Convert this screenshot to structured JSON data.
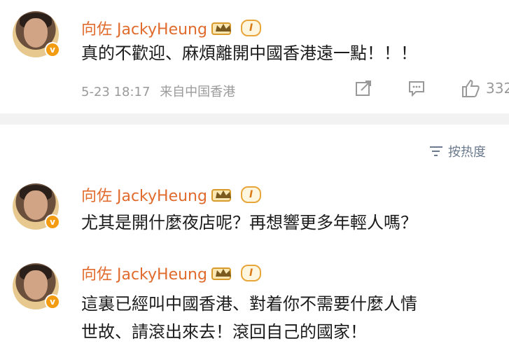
{
  "comments": [
    {
      "user_name": "向佐 JackyHeung",
      "level": "I",
      "text": "真的不歡迎、麻煩離開中國香港遠一點！！！",
      "time": "5-23 18:17",
      "source": "来自中国香港",
      "likes": "332"
    },
    {
      "user_name": "向佐 JackyHeung",
      "level": "I",
      "text": "尤其是開什麼夜店呢？再想響更多年輕人嗎？"
    },
    {
      "user_name": "向佐 JackyHeung",
      "level": "I",
      "text_line1": "這裏已經叫中國香港、對着你不需要什麼人情",
      "text_line2": "世故、請滾出來去！滾回自己的國家！"
    }
  ],
  "sort": {
    "label": "按热度"
  },
  "icons": {
    "verified": "verified-v-icon",
    "crown": "crown-icon",
    "share": "share-icon",
    "comment": "comment-icon",
    "like": "thumbs-up-icon",
    "sort": "sort-icon"
  },
  "colors": {
    "name": "#e06b2d",
    "badge": "#f39c12",
    "meta": "#9a9a9a",
    "sort": "#6b7a8d"
  }
}
